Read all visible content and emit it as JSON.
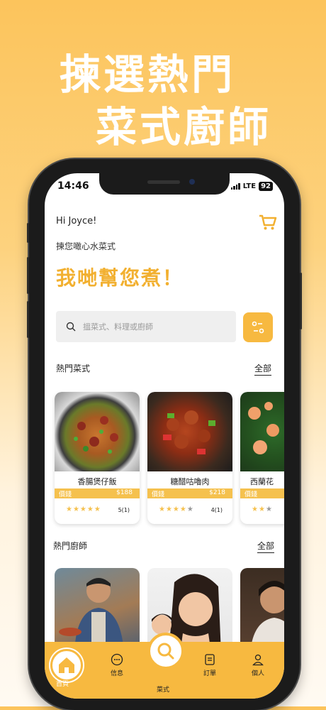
{
  "headline": {
    "line1": "揀選熱門",
    "line2": "菜式廚師"
  },
  "status_bar": {
    "time": "14:46",
    "network": "LTE",
    "battery": "92"
  },
  "header": {
    "greeting": "Hi Joyce!",
    "subtitle": "揀您噉心水菜式",
    "big_title": "我哋幫您煮！"
  },
  "search": {
    "placeholder": "搵菜式、料理或廚師"
  },
  "popular_dishes": {
    "title": "熱門菜式",
    "all_label": "全部",
    "items": [
      {
        "name": "香腸煲仔飯",
        "price_label": "價錢",
        "price": "$188",
        "rating": 5,
        "rating_count": "5(1)"
      },
      {
        "name": "糖醋咕嚕肉",
        "price_label": "價錢",
        "price": "$218",
        "rating": 4,
        "rating_count": "4(1)"
      },
      {
        "name": "西蘭花",
        "price_label": "價錢",
        "price": "",
        "rating": 2,
        "rating_count": ""
      }
    ]
  },
  "popular_chefs": {
    "title": "熱門廚師",
    "all_label": "全部"
  },
  "tabbar": {
    "home": "首頁",
    "messages": "信息",
    "dishes": "菜式",
    "orders": "訂單",
    "profile": "個人"
  },
  "colors": {
    "accent": "#f7b940",
    "title": "#f2b030",
    "star": "#f5c14e"
  },
  "icons": [
    "cart-icon",
    "search-icon",
    "filter-icon",
    "home-icon",
    "chat-icon",
    "search-dish-icon",
    "order-icon",
    "person-icon"
  ]
}
